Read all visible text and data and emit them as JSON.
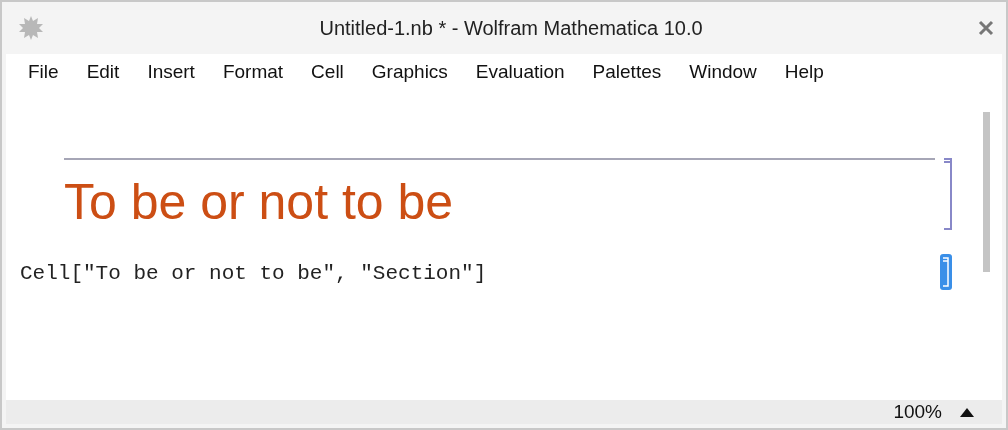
{
  "window": {
    "title": "Untitled-1.nb * - Wolfram Mathematica 10.0"
  },
  "menu": [
    "File",
    "Edit",
    "Insert",
    "Format",
    "Cell",
    "Graphics",
    "Evaluation",
    "Palettes",
    "Window",
    "Help"
  ],
  "cells": [
    {
      "kind": "section",
      "text": "To be or not to be",
      "selected": false
    },
    {
      "kind": "input",
      "text": "Cell[\"To be or not to be\", \"Section\"]",
      "selected": true
    }
  ],
  "status_bar": {
    "zoom": "100%"
  }
}
